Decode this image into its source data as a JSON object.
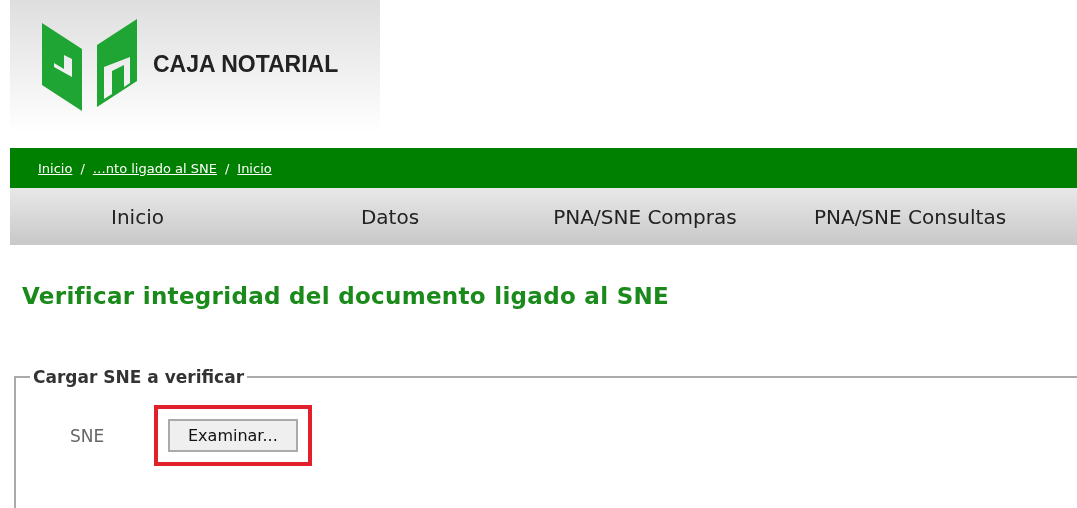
{
  "header": {
    "logo_text": "CAJA NOTARIAL"
  },
  "breadcrumb": [
    {
      "kind": "link",
      "text": "Inicio"
    },
    {
      "kind": "separator",
      "text": "/"
    },
    {
      "kind": "link",
      "text": "…nto ligado al SNE"
    },
    {
      "kind": "separator",
      "text": "/"
    },
    {
      "kind": "link",
      "text": "Inicio"
    }
  ],
  "nav": [
    {
      "label": "Inicio"
    },
    {
      "label": "Datos"
    },
    {
      "label": "PNA/SNE Compras"
    },
    {
      "label": "PNA/SNE Consultas"
    }
  ],
  "page_title": "Verificar integridad del documento ligado al SNE",
  "form": {
    "legend": "Cargar SNE a verificar",
    "field_label": "SNE",
    "button": {
      "label": "Examinar...",
      "highlighted": true
    }
  }
}
